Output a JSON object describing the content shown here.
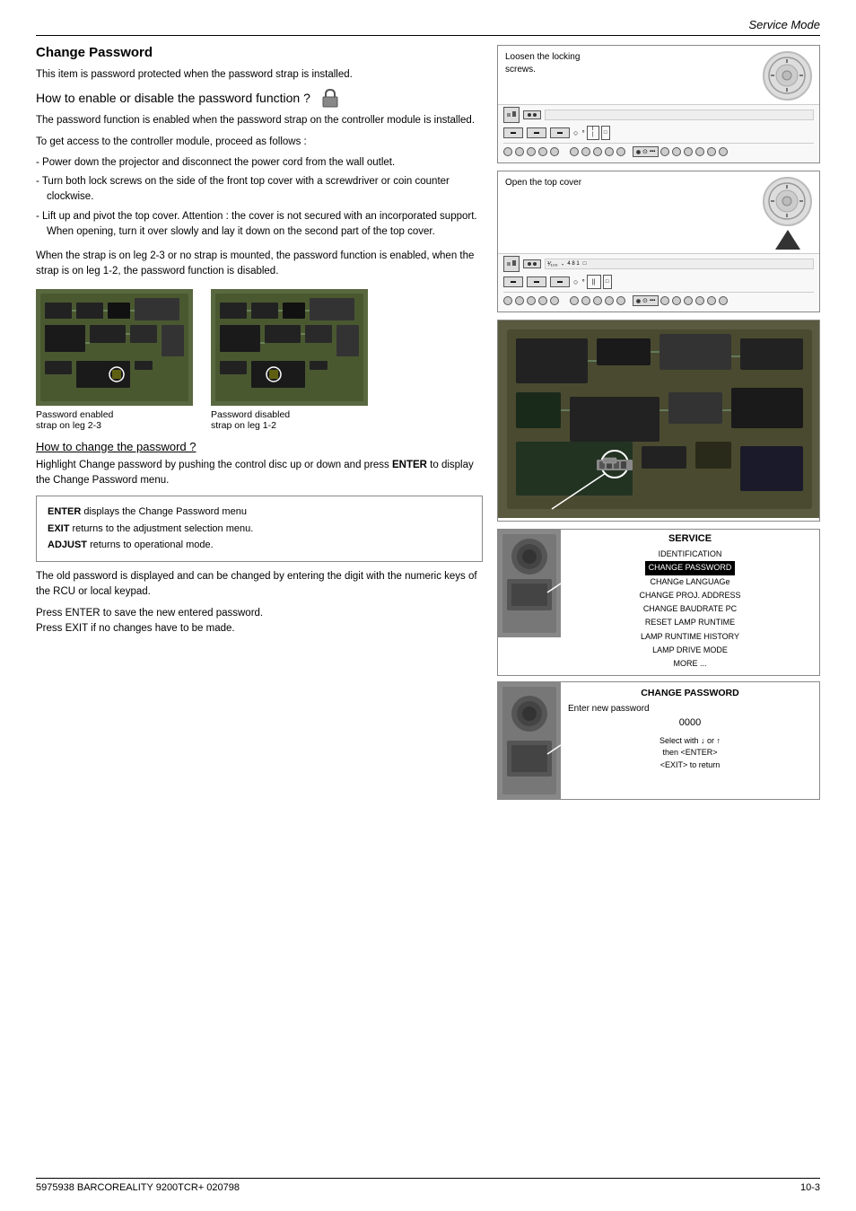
{
  "header": {
    "title": "Service Mode"
  },
  "section": {
    "title": "Change Password",
    "intro": "This item is password protected when the password strap is installed.",
    "how_enable_title": "How to enable or disable the password function ?",
    "enable_body": "The password function is enabled when the password strap on the controller module is installed.",
    "proceed_intro": "To get access to the controller module, proceed as follows :",
    "bullets": [
      "Power down the projector and disconnect the power cord from the wall outlet.",
      "Turn both lock screws on the side of the front top cover with a screwdriver or coin counter clockwise.",
      "Lift up and pivot the top cover.  Attention : the cover is not secured with an incorporated support.  When opening, turn it over slowly and lay it down on the second part of the top cover."
    ],
    "strap_info": "When the strap is on leg 2-3 or no strap is mounted, the password function is enabled, when the strap is on leg 1-2, the password function is disabled.",
    "enabled_caption": "Password enabled\nstrap on leg 2-3",
    "disabled_caption": "Password disabled\nstrap  on leg 1-2",
    "how_change_title": "How to change the password ?",
    "how_change_body": "Highlight Change password by pushing the control disc up or down and press ENTER to display the Change Password menu.",
    "info_enter": "ENTER displays the Change Password menu",
    "info_exit": "EXIT returns to the adjustment selection menu.",
    "info_adjust": "ADJUST returns to operational mode.",
    "old_password_info": "The old password is displayed and can be changed by entering the digit with the numeric keys of the RCU or local keypad.",
    "press_enter": "Press ENTER to save the new entered password.\nPress EXIT if no changes have to be made."
  },
  "diagrams": {
    "loosen_label": "Loosen the locking\nscrews.",
    "open_label": "Open the top cover",
    "service_menu": {
      "title": "SERVICE",
      "items": [
        "IDENTIFICATION",
        "CHANGE PASSWORD",
        "CHANGe LANGUAGe",
        "CHANGE PROJ. ADDRESS",
        "CHANGE BAUDRATE PC",
        "RESET  LAMP RUNTIME",
        "LAMP  RUNTIME  HISTORY",
        "LAMP DRIVE MODE",
        "MORE ..."
      ],
      "highlighted": "CHANGE PASSWORD"
    },
    "change_password_menu": {
      "title": "CHANGE PASSWORD",
      "enter_new": "Enter new password",
      "value": "0000",
      "select_instructions": "Select with  ↓  or ↑\nthen <ENTER>\n<EXIT> to return"
    }
  },
  "footer": {
    "left": "5975938 BARCOREALITY 9200TCR+ 020798",
    "right": "10-3"
  }
}
